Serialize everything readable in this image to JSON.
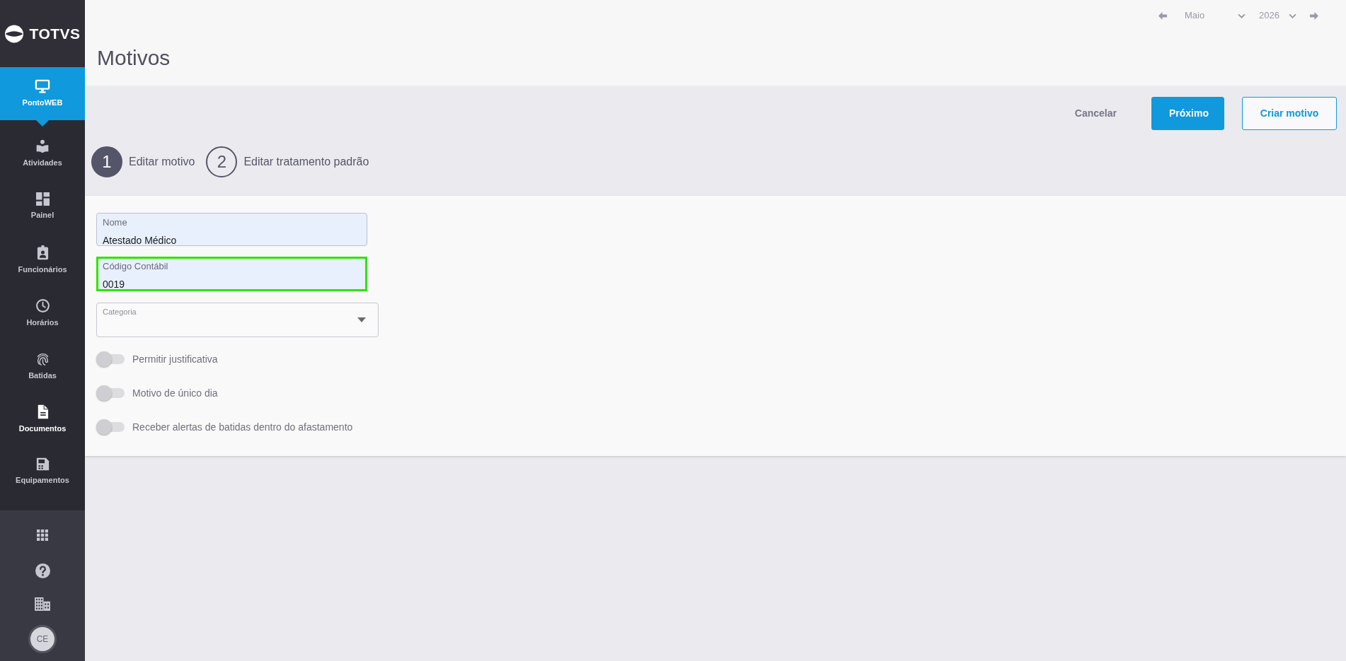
{
  "sidebar": {
    "logo_text": "TOTVS",
    "items": [
      {
        "label": "PontoWEB",
        "selected": true,
        "highlighted": false
      },
      {
        "label": "Atividades",
        "selected": false,
        "highlighted": false
      },
      {
        "label": "Painel",
        "selected": false,
        "highlighted": false
      },
      {
        "label": "Funcionários",
        "selected": false,
        "highlighted": false
      },
      {
        "label": "Horários",
        "selected": false,
        "highlighted": false
      },
      {
        "label": "Batidas",
        "selected": false,
        "highlighted": false
      },
      {
        "label": "Documentos",
        "selected": false,
        "highlighted": true
      },
      {
        "label": "Equipamentos",
        "selected": false,
        "highlighted": false
      }
    ],
    "user": {
      "initials": "CE"
    }
  },
  "header": {
    "month": "Maio",
    "year": "2026",
    "title": "Motivos"
  },
  "actions": [
    {
      "label": "Cancelar",
      "kind": "link"
    },
    {
      "label": "Próximo",
      "kind": "primary"
    },
    {
      "label": "Criar motivo",
      "kind": "outline"
    }
  ],
  "steps": [
    {
      "number": "1",
      "label": "Editar motivo",
      "selected": true
    },
    {
      "number": "2",
      "label": "Editar tratamento padrão",
      "selected": false
    }
  ],
  "form": {
    "fields": [
      {
        "kind": "text",
        "label": "Nome",
        "value": "Atestado Médico",
        "highlighted": false
      },
      {
        "kind": "text",
        "label": "Código Contábil",
        "value": "0019",
        "highlighted": true
      },
      {
        "kind": "select",
        "label": "Categoria"
      }
    ],
    "toggles": [
      {
        "label": "Permitir justificativa",
        "on": false
      },
      {
        "label": "Motivo de único dia",
        "on": false
      },
      {
        "label": "Receber alertas de batidas dentro do afastamento",
        "on": false
      }
    ]
  }
}
